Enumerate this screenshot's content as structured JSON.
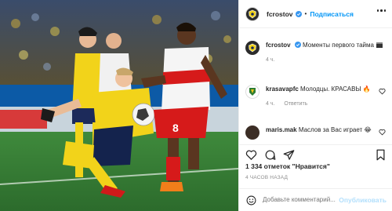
{
  "post": {
    "author": "fcrostov",
    "follow_label": "Подписаться",
    "caption": "Моменты первого тайма",
    "caption_time": "4 ч.",
    "comments": [
      {
        "user": "krasavapfc",
        "text": "Молодцы. КРАСАВЫ 🔥",
        "time": "4 ч.",
        "reply_label": "Ответить"
      },
      {
        "user": "maris.mak",
        "text": "Маслов за Вас играет 😂"
      }
    ],
    "likes_text": "1 334 отметок \"Нравится\"",
    "timestamp": "4 ЧАСОВ НАЗАД",
    "add_comment_placeholder": "Добавьте комментарий...",
    "publish_label": "Опубликовать"
  },
  "colors": {
    "accent": "#0095f6",
    "muted": "#8e8e8e",
    "publish_disabled": "#b2dffc"
  },
  "icons": [
    "ellipsis-icon",
    "verified-icon",
    "heart-icon",
    "comment-icon",
    "share-icon",
    "bookmark-icon",
    "emoji-icon"
  ]
}
